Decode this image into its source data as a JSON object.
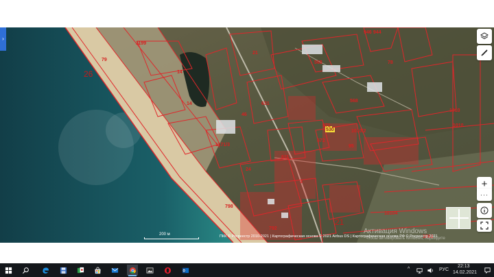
{
  "map": {
    "labels": {
      "district_26": "26",
      "parcel_1199": "1199",
      "parcel_79": "79",
      "parcel_14a": "14",
      "parcel_14b": "14",
      "parcel_21": "21",
      "parcel_568a": "568",
      "parcel_568b": "568",
      "parcel_631": "631",
      "parcel_1171_3": "1171/3",
      "parcel_1010_2": "1010/2",
      "parcel_10104": "10104",
      "parcel_1010_top": "1010",
      "parcel_1010_side": "1010",
      "parcel_21_low": "21",
      "parcel_798": "798",
      "parcel_792": "792",
      "parcel_24": "24",
      "parcel_611": "611",
      "parcel_3": "3",
      "parcel_46": "46",
      "parcel_530": "530",
      "parcel_571": "571",
      "parcel_572": "572",
      "parcel_95": "95",
      "parcel_946": "946",
      "parcel_944": "944",
      "parcel_78": "78",
      "parcel_1062": "1062"
    },
    "scale_label": "200 м",
    "attribution": "ПКК © Росреестр 2010-2021 | Картографическая основа © 2021 Airbus DS | Картографическая основа РФ © Росреестр 2021",
    "watermark_title": "Активация Windows",
    "watermark_subtitle": "Чтобы активировать Windows, перейдите"
  },
  "controls": {
    "sidebar_toggle_icon": "chevron-right-icon",
    "zoom_in_label": "+",
    "zoom_more_label": "···",
    "layers_icon": "layers-icon",
    "ruler_icon": "ruler-icon",
    "info_icon": "info-icon",
    "fullscreen_icon": "fullscreen-icon"
  },
  "taskbar": {
    "apps": [
      {
        "name": "start",
        "icon": "windows-icon"
      },
      {
        "name": "search",
        "icon": "search-icon"
      },
      {
        "name": "task-view",
        "icon": "task-view-icon"
      },
      {
        "name": "edge",
        "icon": "edge-icon"
      },
      {
        "name": "save",
        "icon": "floppy-icon"
      },
      {
        "name": "solitaire",
        "icon": "cards-icon"
      },
      {
        "name": "store",
        "icon": "store-icon"
      },
      {
        "name": "mail",
        "icon": "mail-icon"
      },
      {
        "name": "chrome",
        "icon": "chrome-icon"
      },
      {
        "name": "photos",
        "icon": "photos-icon"
      },
      {
        "name": "opera",
        "icon": "opera-icon"
      },
      {
        "name": "outlook",
        "icon": "outlook-icon"
      }
    ],
    "tray": {
      "up_arrow": "^",
      "language": "РУС",
      "time": "22:13",
      "date": "14.02.2021"
    }
  },
  "colors": {
    "parcel_border": "#e0262a",
    "sea": "#18505a",
    "beach": "#d8c8a5",
    "land": "#5b5a43",
    "taskbar": "#14171b",
    "accent": "#2f6fd6"
  }
}
